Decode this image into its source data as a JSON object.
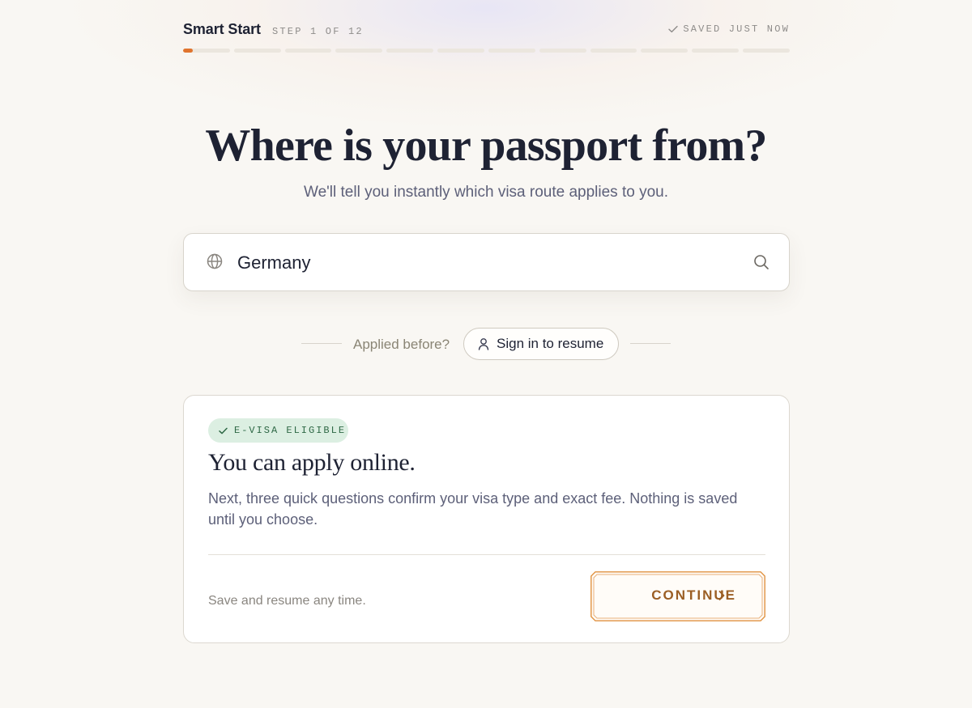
{
  "header": {
    "brand": "Smart Start",
    "step_text": "STEP 1 OF 12",
    "saved_text": "SAVED JUST NOW",
    "progress": {
      "current_step": 1,
      "total_steps": 12,
      "current_fraction": 0.2
    }
  },
  "hero": {
    "title": "Where is your passport from?",
    "subtitle": "We'll tell you instantly which visa route applies to you."
  },
  "search": {
    "value": "Germany",
    "globe_icon": "globe-icon",
    "search_icon": "search-icon"
  },
  "resume": {
    "prompt": "Applied before?",
    "button_label": "Sign in to resume",
    "icon": "user-icon"
  },
  "result": {
    "badge": "E-VISA ELIGIBLE",
    "title": "You can apply online.",
    "body": "Next, three quick questions confirm your visa type and exact fee. Nothing is saved until you choose.",
    "footnote": "Save and resume any time.",
    "cta_label": "CONTINUE"
  },
  "colors": {
    "accent": "#e0742e",
    "cta_text": "#9b5e24",
    "badge_bg": "#dcefe2",
    "badge_text": "#2e6845",
    "page_bg": "#f9f7f3"
  }
}
